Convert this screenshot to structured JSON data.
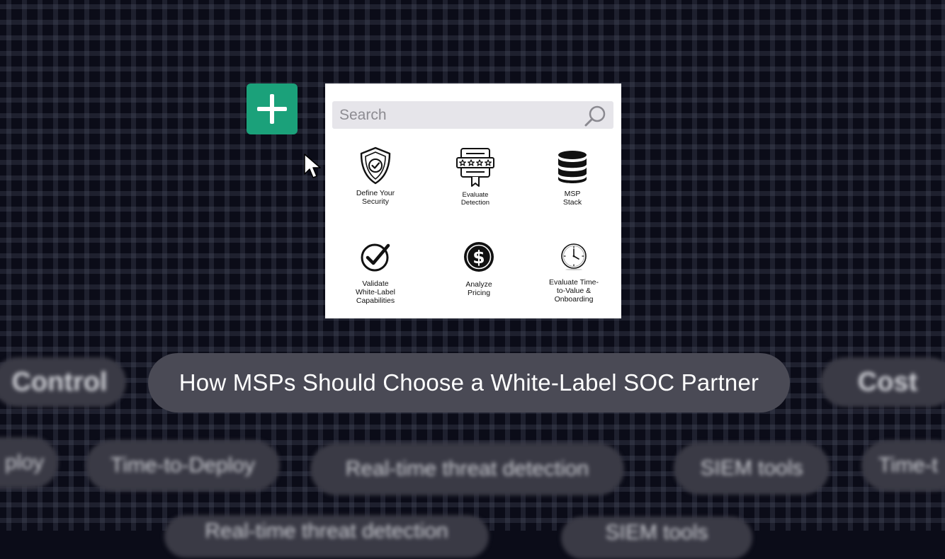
{
  "search": {
    "placeholder": "Search"
  },
  "tiles": [
    {
      "icon": "shield-check-icon",
      "label": "Define Your\nSecurity"
    },
    {
      "icon": "review-stars-certificate-icon",
      "label": "Evaluate\nDetection"
    },
    {
      "icon": "database-stack-icon",
      "label": "MSP\nStack"
    },
    {
      "icon": "checkmark-circle-icon",
      "label": "Validate\nWhite-Label\nCapabilities"
    },
    {
      "icon": "dollar-coin-icon",
      "label": "Analyze\nPricing"
    },
    {
      "icon": "clock-icon",
      "label": "Evaluate Time-\nto-Value &\nOnboarding"
    }
  ],
  "headline": "How MSPs Should Choose a White-Label SOC Partner",
  "blurred_tags": {
    "row1_left": "Control",
    "row1_right": "Cost",
    "row2_a": "ploy",
    "row2_b": "Time-to-Deploy",
    "row2_c": "Real-time threat detection",
    "row2_d": "SIEM tools",
    "row2_e": "Time-t",
    "row3_a": "Real-time threat detection",
    "row3_b": "SIEM tools"
  },
  "colors": {
    "background": "#0b0c18",
    "accent_green": "#1ba17a",
    "pill": "#4a4a55"
  }
}
